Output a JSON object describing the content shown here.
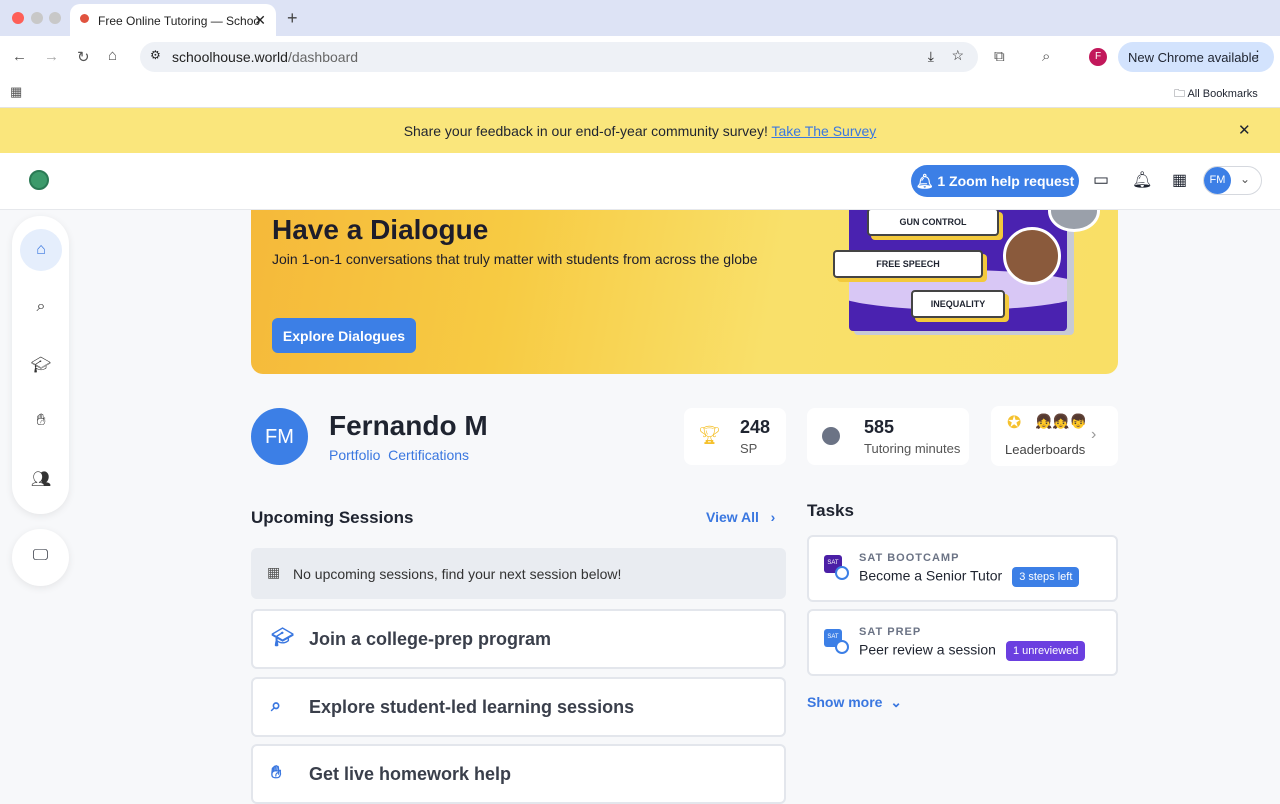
{
  "browser": {
    "tab_title": "Free Online Tutoring — Schoo",
    "url_host": "schoolhouse.world",
    "url_path": "/dashboard",
    "new_chrome": "New Chrome available",
    "all_bookmarks": "All Bookmarks",
    "profile_initial": "F"
  },
  "banner": {
    "text": "Share your feedback in our end-of-year community survey! ",
    "link": "Take The Survey"
  },
  "header": {
    "zoom_help": "1 Zoom help request",
    "avatar": "FM"
  },
  "hero": {
    "title": "Have a Dialogue",
    "subtitle": "Join 1-on-1 conversations that truly matter with students from across the globe",
    "button": "Explore Dialogues",
    "topics": [
      "GUN CONTROL",
      "FREE SPEECH",
      "INEQUALITY"
    ]
  },
  "profile": {
    "initials": "FM",
    "name": "Fernando M",
    "links": [
      "Portfolio",
      "Certifications"
    ]
  },
  "stats": {
    "sp_value": "248",
    "sp_label": "SP",
    "minutes_value": "585",
    "minutes_label": "Tutoring minutes",
    "leaderboards": "Leaderboards"
  },
  "sessions": {
    "title": "Upcoming Sessions",
    "view_all": "View All",
    "empty": "No upcoming sessions, find your next session below!",
    "actions": [
      "Join a college-prep program",
      "Explore student-led learning sessions",
      "Get live homework help"
    ]
  },
  "tasks": {
    "title": "Tasks",
    "items": [
      {
        "category": "SAT BOOTCAMP",
        "title": "Become a Senior Tutor",
        "badge": "3 steps left",
        "badge_color": "#3c7fe6",
        "icon_color": "#4b1fa6"
      },
      {
        "category": "SAT PREP",
        "title": "Peer review a session",
        "badge": "1 unreviewed",
        "badge_color": "#6b3fe0",
        "icon_color": "#3c7fe6"
      }
    ],
    "show_more": "Show more"
  }
}
